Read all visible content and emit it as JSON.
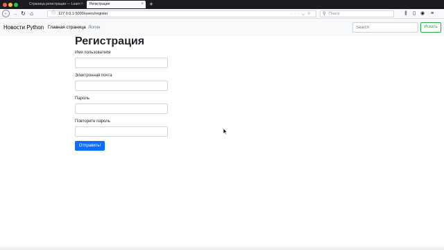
{
  "browser": {
    "tabs": [
      {
        "title": "Страница регистрации — Learn",
        "active": false
      },
      {
        "title": "Регистрация",
        "active": true
      }
    ],
    "tab_close_glyph": "×",
    "new_tab_glyph": "+",
    "url": "127.0.0.1:5000/users/register",
    "search_placeholder": "Поиск",
    "icons": [
      "back-icon",
      "forward-icon",
      "reload-icon",
      "home-icon",
      "info-icon",
      "more-icon",
      "pocket-icon",
      "bookmark-icon",
      "search-icon",
      "library-icon",
      "sidebar-icon",
      "account-icon",
      "menu-icon"
    ]
  },
  "site": {
    "brand": "Новости Python",
    "nav": {
      "home": "Главная страница",
      "login": "Логин"
    },
    "search": {
      "placeholder": "Search",
      "button": "Искать"
    }
  },
  "form": {
    "title": "Регистрация",
    "fields": [
      {
        "label": "Имя пользователя",
        "value": ""
      },
      {
        "label": "Электронная почта",
        "value": ""
      },
      {
        "label": "Пароль",
        "value": ""
      },
      {
        "label": "Повторите пароль",
        "value": ""
      }
    ],
    "submit_label": "Отправить!"
  },
  "colors": {
    "primary": "#0d6efd",
    "success": "#28a745",
    "navbar_bg": "#f8f9fa",
    "tab_strip": "#1c1b22"
  }
}
